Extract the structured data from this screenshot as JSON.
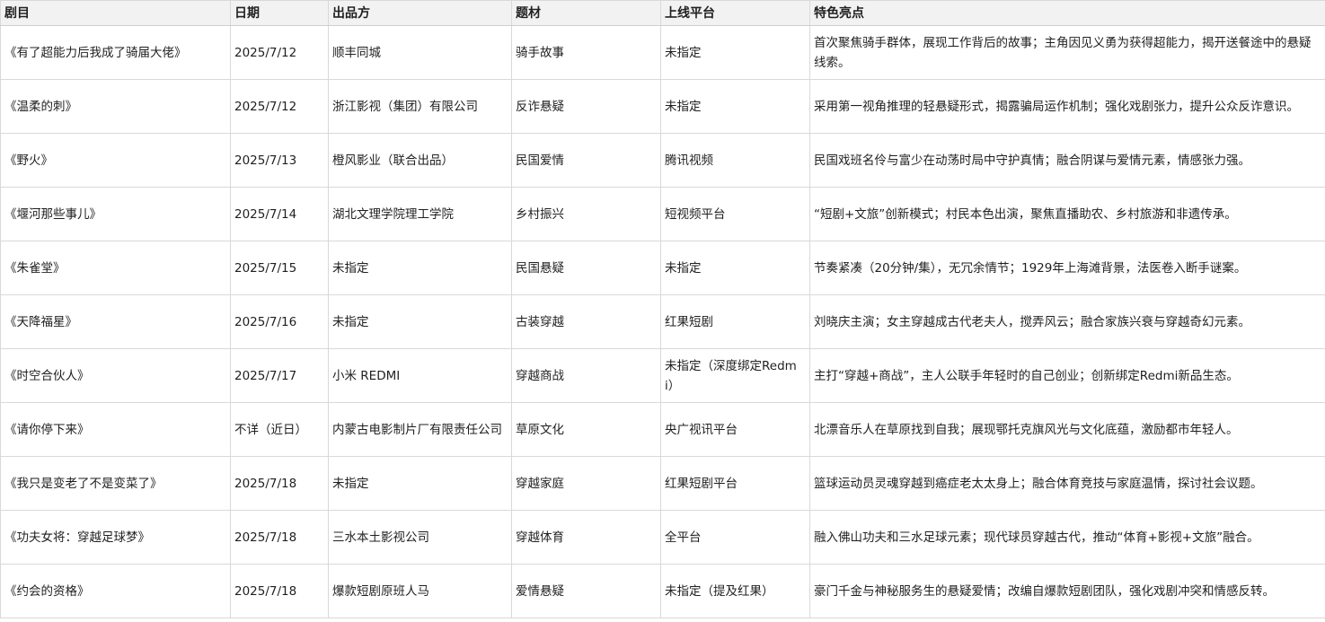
{
  "columns": [
    "剧目",
    "日期",
    "出品方",
    "题材",
    "上线平台",
    "特色亮点"
  ],
  "rows": [
    {
      "title": "《有了超能力后我成了骑届大佬》",
      "date": "2025/7/12",
      "producer": "顺丰同城",
      "genre": "骑手故事",
      "platform": "未指定",
      "feature": "首次聚焦骑手群体，展现工作背后的故事；主角因见义勇为获得超能力，揭开送餐途中的悬疑线索。"
    },
    {
      "title": "《温柔的刺》",
      "date": "2025/7/12",
      "producer": "浙江影视（集团）有限公司",
      "genre": "反诈悬疑",
      "platform": "未指定",
      "feature": "采用第一视角推理的轻悬疑形式，揭露骗局运作机制；强化戏剧张力，提升公众反诈意识。"
    },
    {
      "title": "《野火》",
      "date": "2025/7/13",
      "producer": "橙风影业（联合出品）",
      "genre": "民国爱情",
      "platform": "腾讯视频",
      "feature": "民国戏班名伶与富少在动荡时局中守护真情；融合阴谋与爱情元素，情感张力强。"
    },
    {
      "title": "《堰河那些事儿》",
      "date": "2025/7/14",
      "producer": "湖北文理学院理工学院",
      "genre": "乡村振兴",
      "platform": "短视频平台",
      "feature": "“短剧+文旅”创新模式；村民本色出演，聚焦直播助农、乡村旅游和非遗传承。"
    },
    {
      "title": "《朱雀堂》",
      "date": "2025/7/15",
      "producer": "未指定",
      "genre": "民国悬疑",
      "platform": "未指定",
      "feature": "节奏紧凑（20分钟/集），无冗余情节；1929年上海滩背景，法医卷入断手谜案。"
    },
    {
      "title": "《天降福星》",
      "date": "2025/7/16",
      "producer": "未指定",
      "genre": "古装穿越",
      "platform": "红果短剧",
      "feature": "刘晓庆主演；女主穿越成古代老夫人，搅弄风云；融合家族兴衰与穿越奇幻元素。"
    },
    {
      "title": "《时空合伙人》",
      "date": "2025/7/17",
      "producer": "小米 REDMI",
      "genre": "穿越商战",
      "platform": "未指定（深度绑定Redmi）",
      "feature": "主打“穿越+商战”，主人公联手年轻时的自己创业；创新绑定Redmi新品生态。"
    },
    {
      "title": "《请你停下来》",
      "date": "不详（近日）",
      "producer": "内蒙古电影制片厂有限责任公司",
      "genre": "草原文化",
      "platform": "央广视讯平台",
      "feature": "北漂音乐人在草原找到自我；展现鄂托克旗风光与文化底蕴，激励都市年轻人。"
    },
    {
      "title": "《我只是变老了不是变菜了》",
      "date": "2025/7/18",
      "producer": "未指定",
      "genre": "穿越家庭",
      "platform": "红果短剧平台",
      "feature": "篮球运动员灵魂穿越到癌症老太太身上；融合体育竞技与家庭温情，探讨社会议题。"
    },
    {
      "title": "《功夫女将：穿越足球梦》",
      "date": "2025/7/18",
      "producer": "三水本土影视公司",
      "genre": "穿越体育",
      "platform": "全平台",
      "feature": "融入佛山功夫和三水足球元素；现代球员穿越古代，推动“体育+影视+文旅”融合。"
    },
    {
      "title": "《约会的资格》",
      "date": "2025/7/18",
      "producer": "爆款短剧原班人马",
      "genre": "爱情悬疑",
      "platform": "未指定（提及红果）",
      "feature": "豪门千金与神秘服务生的悬疑爱情；改编自爆款短剧团队，强化戏剧冲突和情感反转。"
    }
  ]
}
